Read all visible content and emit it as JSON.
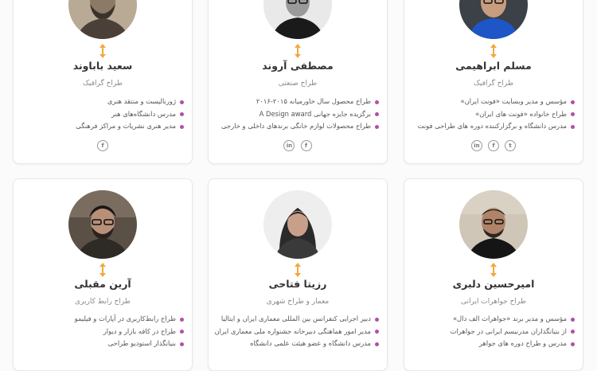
{
  "cards": [
    {
      "name": "مسلم ابراهیمی",
      "role": "طراح گرافیک",
      "items": [
        "مؤسس و مدیر وبسایت «فونت ایران»",
        "طراح خانواده «فونت های ایران»",
        "مدرس دانشگاه و برگزارکننده دوره های طراحی فونت"
      ],
      "socials": [
        {
          "icon": "twitter-icon",
          "glyph": "t"
        },
        {
          "icon": "facebook-icon",
          "glyph": "f"
        },
        {
          "icon": "linkedin-icon",
          "glyph": "in"
        }
      ]
    },
    {
      "name": "مصطفی آروند",
      "role": "طراح صنعتی",
      "items": [
        "طراح محصول سال خاورمیانه ۲۰۱۵-۲۰۱۶",
        "برگزیده جایزه جهانی A Design award",
        "طراح محصولات لوازم خانگی برندهای داخلی و خارجی"
      ],
      "socials": [
        {
          "icon": "facebook-icon",
          "glyph": "f"
        },
        {
          "icon": "linkedin-icon",
          "glyph": "in"
        }
      ]
    },
    {
      "name": "سعید باباوند",
      "role": "طراح گرافیک",
      "items": [
        "ژورنالیست و منتقد هنری",
        "مدرس دانشگاه‌های هنر",
        "مدیر هنری نشریات و مراکز فرهنگی"
      ],
      "socials": [
        {
          "icon": "facebook-icon",
          "glyph": "f"
        }
      ]
    },
    {
      "name": "امیرحسین دلبری",
      "role": "طراح جواهرات ایرانی",
      "items": [
        "مؤسس و مدیر برند «جواهرات الف دال»",
        "از بنیانگذاران مدرنیسم ایرانی در جواهرات",
        "مدرس و طراح دوره های جواهر"
      ],
      "socials": []
    },
    {
      "name": "رزیتا فتاحی",
      "role": "معمار و طراح شهری",
      "items": [
        "دبیر اجرایی کنفرانس بین المللی معماری ایران و ایتالیا",
        "مدیر امور هماهنگی دبیرخانه جشنواره ملی معماری ایران",
        "مدرس دانشگاه و عضو هیئت علمی دانشگاه"
      ],
      "socials": []
    },
    {
      "name": "آرین مقبلی",
      "role": "طراح رابط کاربری",
      "items": [
        "طراح رابط‌کاربری در آپارات و فیلیمو",
        "طراح در کافه بازار و دیوار",
        "بنیانگذار استودیو طراحی"
      ],
      "socials": []
    }
  ]
}
